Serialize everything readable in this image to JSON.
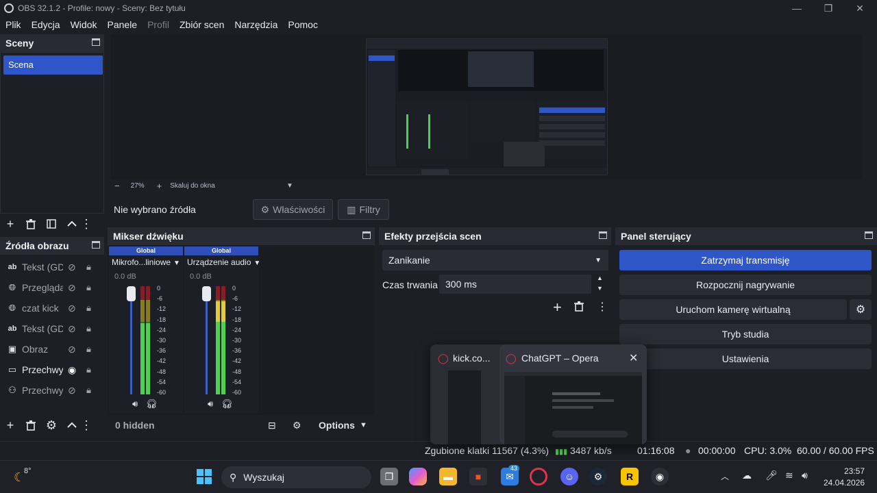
{
  "window": {
    "title": "OBS 32.1.2 - Profile: nowy - Sceny: Bez tytułu"
  },
  "menu": [
    "Plik",
    "Edycja",
    "Widok",
    "Panele",
    "Profil",
    "Zbiór scen",
    "Narzędzia",
    "Pomoc"
  ],
  "scenes": {
    "header": "Sceny",
    "items": [
      "Scena"
    ]
  },
  "preview": {
    "zoom": "27%",
    "scale_mode": "Skaluj do okna"
  },
  "source_bar": {
    "none_selected": "Nie wybrano źródła",
    "properties": "Właściwości",
    "filters": "Filtry"
  },
  "sources": {
    "header": "Źródła obrazu",
    "items": [
      {
        "icon": "ab",
        "label": "Tekst (GDI+)",
        "visible": false
      },
      {
        "icon": "globe",
        "label": "Przeglądarka",
        "visible": false
      },
      {
        "icon": "globe",
        "label": "czat kick",
        "visible": false
      },
      {
        "icon": "ab",
        "label": "Tekst (GDI+)",
        "visible": false
      },
      {
        "icon": "image",
        "label": "Obraz",
        "visible": false
      },
      {
        "icon": "monitor",
        "label": "Przechwytywanie",
        "visible": true
      },
      {
        "icon": "gamepad",
        "label": "Przechwytywanie gry",
        "visible": false
      }
    ]
  },
  "mixer": {
    "header": "Mikser dźwięku",
    "channels": [
      {
        "tag": "Global",
        "name": "Mikrofo...liniowe",
        "db": "0.0 dB",
        "level": 0.66
      },
      {
        "tag": "Global",
        "name": "Urządzenie audio",
        "db": "0.0 dB",
        "level": 0.86
      }
    ],
    "ticks": [
      "0",
      "-6",
      "-12",
      "-18",
      "-24",
      "-30",
      "-36",
      "-42",
      "-48",
      "-54",
      "-60"
    ],
    "hidden": "0 hidden",
    "options": "Options"
  },
  "transitions": {
    "header": "Efekty przejścia scen",
    "selected": "Zanikanie",
    "duration_label": "Czas trwania",
    "duration_value": "300 ms"
  },
  "controls": {
    "header": "Panel sterujący",
    "buttons": [
      "Zatrzymaj transmisję",
      "Rozpocznij nagrywanie",
      "Uruchom kamerę wirtualną",
      "Tryb studia",
      "Ustawienia"
    ]
  },
  "status": {
    "dropped": "Zgubione klatki 11567 (4.3%)",
    "bitrate": "3487 kb/s",
    "stream_time": "01:16:08",
    "rec_time": "00:00:00",
    "cpu": "CPU: 3.0%",
    "fps": "60.00 / 60.00 FPS"
  },
  "taskbar_popup": {
    "items": [
      "kick.co...",
      "ChatGPT – Opera"
    ]
  },
  "taskbar": {
    "weather": "8°",
    "search_placeholder": "Wyszukaj",
    "badge_teams": "43",
    "time": "23:57",
    "date": "24.04.2026"
  }
}
